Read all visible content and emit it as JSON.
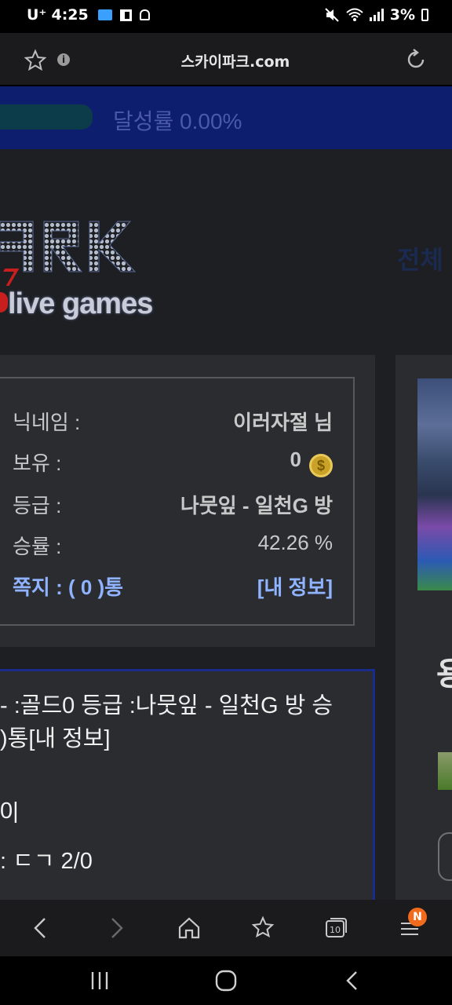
{
  "status_bar": {
    "carrier": "U⁺",
    "time": "4:25",
    "battery": "3%",
    "icons_left": [
      "folder-icon",
      "gallery-icon",
      "ghost-icon"
    ],
    "icons_right": [
      "mute-icon",
      "wifi-icon",
      "signal-icon",
      "battery-icon"
    ]
  },
  "address_bar": {
    "url": "스카이파크.com",
    "icons": [
      "star-icon",
      "info-icon",
      "reload-icon"
    ]
  },
  "progress": {
    "label": "달성률 0.00%",
    "value": 0.0
  },
  "logo": {
    "word": "ARK",
    "subtitle": "live games"
  },
  "top_menu": {
    "partial_label": "전체"
  },
  "user_panel": {
    "nickname_label": "닉네임 :",
    "nickname_value": "이러자절 님",
    "holdings_label": "보유 :",
    "holdings_value": "0",
    "grade_label": "등급 :",
    "grade_value": "나뭇잎 - 일천G 방",
    "winrate_label": "승률 :",
    "winrate_value": "42.26 %",
    "messages_label": "쪽지 : ( 0 )통",
    "my_info_link": "[내 정보]"
  },
  "right_panel": {
    "heading_partial": "용"
  },
  "chat": {
    "lines": [
      "- :골드0 등급 :나뭇잎 - 일천G 방 승",
      ")통[내 정보]",
      "",
      "0|",
      ": ㄷㄱ 2/0"
    ]
  },
  "toolbar": {
    "buttons": [
      "back-icon",
      "forward-icon",
      "home-icon",
      "bookmarks-icon",
      "tabs-icon",
      "menu-icon"
    ],
    "tabs_count": "10",
    "menu_badge": "N"
  },
  "nav": {
    "buttons": [
      "recents-icon",
      "home-circle-icon",
      "back-arrow-icon"
    ]
  },
  "colors": {
    "accent_blue": "#8fb3ff",
    "banner_blue": "#0d1e6e",
    "badge_orange": "#f26b1d"
  }
}
